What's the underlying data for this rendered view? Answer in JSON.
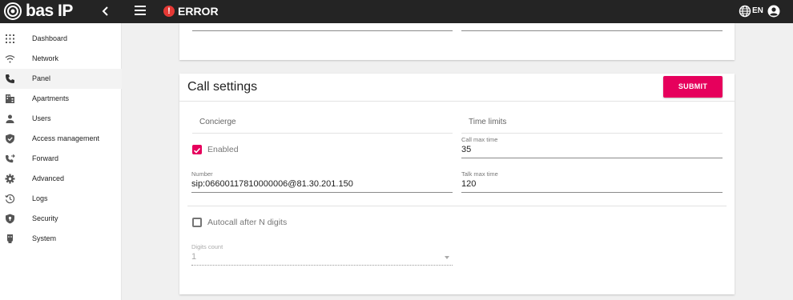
{
  "header": {
    "brand": "bas IP",
    "collapse_icon": "chevron-left-icon",
    "menu_icon": "hamburger-menu-icon",
    "error_icon": "!",
    "error_text": "ERROR",
    "language": "EN",
    "globe_icon": "globe-icon",
    "account_icon": "account-circle-icon"
  },
  "sidebar": {
    "items": [
      {
        "label": "Dashboard",
        "icon": "grid-icon"
      },
      {
        "label": "Network",
        "icon": "wifi-icon"
      },
      {
        "label": "Panel",
        "icon": "phone-icon",
        "active": true
      },
      {
        "label": "Apartments",
        "icon": "building-icon"
      },
      {
        "label": "Users",
        "icon": "person-icon"
      },
      {
        "label": "Access management",
        "icon": "shield-check-icon"
      },
      {
        "label": "Forward",
        "icon": "phone-forward-icon"
      },
      {
        "label": "Advanced",
        "icon": "gear-icon"
      },
      {
        "label": "Logs",
        "icon": "history-icon"
      },
      {
        "label": "Security",
        "icon": "shield-lock-icon"
      },
      {
        "label": "System",
        "icon": "memory-icon"
      }
    ]
  },
  "call_settings": {
    "title": "Call settings",
    "submit_label": "SUBMIT",
    "concierge": {
      "section_label": "Concierge",
      "enabled_label": "Enabled",
      "enabled_checked": true,
      "number_label": "Number",
      "number_value": "sip:06600117810000006@81.30.201.150"
    },
    "time_limits": {
      "section_label": "Time limits",
      "call_max_label": "Call max time",
      "call_max_value": "35",
      "talk_max_label": "Talk max time",
      "talk_max_value": "120"
    },
    "autocall": {
      "label": "Autocall after N digits",
      "checked": false,
      "digits_label": "Digits count",
      "digits_value": "1"
    }
  },
  "colors": {
    "accent": "#e6005c",
    "topbar": "#242424",
    "error": "#e53935"
  }
}
